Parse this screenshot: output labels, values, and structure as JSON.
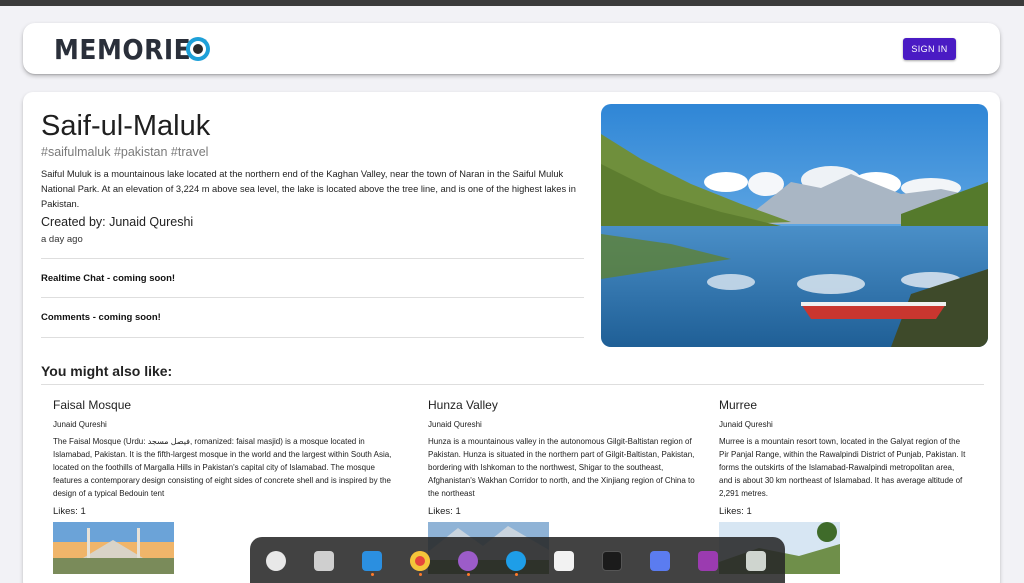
{
  "app": {
    "logo_text": "MEMORIES",
    "signin_label": "SIGN IN",
    "accent": "#4a1bc4"
  },
  "post": {
    "title": "Saif-ul-Maluk",
    "tags": "#saifulmaluk #pakistan #travel",
    "description": "Saiful Muluk is a mountainous lake located at the northern end of the Kaghan Valley, near the town of Naran in the Saiful Muluk National Park. At an elevation of 3,224 m above sea level, the lake is located above the tree line, and is one of the highest lakes in Pakistan.",
    "creator": "Created by: Junaid Qureshi",
    "time": "a day ago",
    "chat_label": "Realtime Chat - coming soon!",
    "comments_label": "Comments - coming soon!"
  },
  "recommendations": {
    "heading": "You might also like:",
    "items": [
      {
        "title": "Faisal Mosque",
        "author": "Junaid Qureshi",
        "description": "The Faisal Mosque (Urdu: فیصل مسجد, romanized: faisal masjid) is a mosque located in Islamabad, Pakistan. It is the fifth-largest mosque in the world and the largest within South Asia, located on the foothills of Margalla Hills in Pakistan's capital city of Islamabad. The mosque features a contemporary design consisting of eight sides of concrete shell and is inspired by the design of a typical Bedouin tent",
        "likes": "Likes: 1"
      },
      {
        "title": "Hunza Valley",
        "author": "Junaid Qureshi",
        "description": "Hunza is a mountainous valley in the autonomous Gilgit-Baltistan region of Pakistan. Hunza is situated in the northern part of Gilgit-Baltistan, Pakistan, bordering with Ishkoman to the northwest, Shigar to the southeast, Afghanistan's Wakhan Corridor to north, and the Xinjiang region of China to the northeast",
        "likes": "Likes: 1"
      },
      {
        "title": "Murree",
        "author": "Junaid Qureshi",
        "description": "Murree is a mountain resort town, located in the Galyat region of the Pir Panjal Range, within the Rawalpindi District of Punjab, Pakistan. It forms the outskirts of the Islamabad-Rawalpindi metropolitan area, and is about 30 km northeast of Islamabad. It has average altitude of 2,291 metres.",
        "likes": "Likes: 1"
      }
    ]
  },
  "dock": {
    "items": [
      "app-grid-icon",
      "files-icon",
      "vscode-icon",
      "chrome-icon",
      "github-desktop-icon",
      "skype-icon",
      "text-editor-icon",
      "terminal-icon",
      "screenshot-icon",
      "media-icon",
      "trash-icon"
    ]
  }
}
